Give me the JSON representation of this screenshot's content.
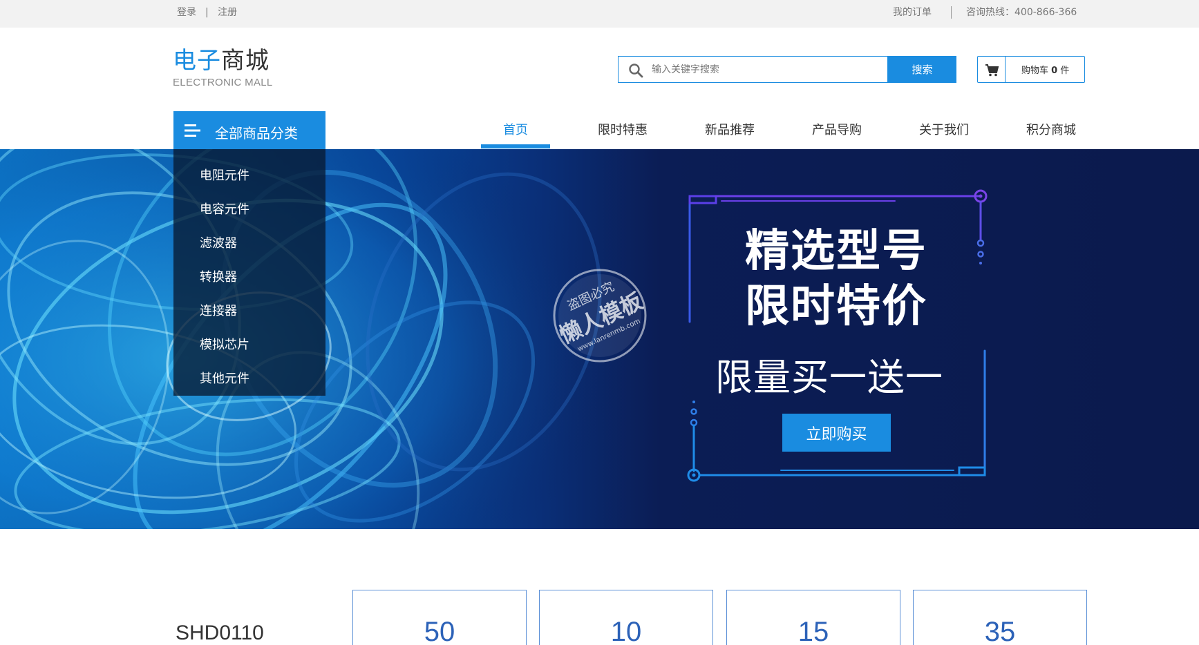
{
  "topbar": {
    "login": "登录",
    "separator": "|",
    "register": "注册",
    "my_orders": "我的订单",
    "hotline": "咨询热线：400-866-366"
  },
  "logo": {
    "cn_highlight": "电子",
    "cn_rest": "商城",
    "en": "ELECTRONIC MALL"
  },
  "search": {
    "placeholder": "输入关键字搜索",
    "button": "搜索"
  },
  "cart": {
    "label": "购物车",
    "count": "0",
    "unit": "件"
  },
  "category": {
    "head": "全部商品分类",
    "items": [
      "电阻元件",
      "电容元件",
      "滤波器",
      "转换器",
      "连接器",
      "模拟芯片",
      "其他元件"
    ]
  },
  "nav": [
    "首页",
    "限时特惠",
    "新品推荐",
    "产品导购",
    "关于我们",
    "积分商城"
  ],
  "banner": {
    "line1": "精选型号",
    "line2": "限时特价",
    "line3": "限量买一送一",
    "button": "立即购买",
    "watermark_top": "盗图必究",
    "watermark_main": "懒人模板",
    "watermark_url": "www.lanrenmb.com"
  },
  "stats": {
    "title_partial": "SHD0110",
    "values": [
      "50",
      "10",
      "15",
      "35"
    ]
  },
  "colors": {
    "accent": "#1a8ce0",
    "banner_dark": "#0b1a4d",
    "stat_text": "#2c62b8"
  }
}
